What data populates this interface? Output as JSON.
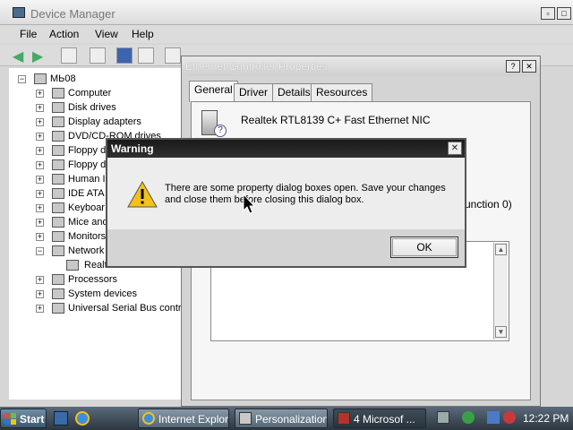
{
  "device_manager": {
    "title": "Device Manager",
    "menu": [
      "File",
      "Action",
      "View",
      "Help"
    ],
    "tree": {
      "root": "МЬ08",
      "items": [
        {
          "label": "Computer",
          "icon": "computer-icon",
          "expander": "+"
        },
        {
          "label": "Disk drives",
          "icon": "disk-icon",
          "expander": "+"
        },
        {
          "label": "Display adapters",
          "icon": "display-icon",
          "expander": "+"
        },
        {
          "label": "DVD/CD-ROM drives",
          "icon": "dvd-icon",
          "expander": "+"
        },
        {
          "label": "Floppy di",
          "icon": "floppy-icon",
          "expander": "+"
        },
        {
          "label": "Floppy di",
          "icon": "floppy-drive-icon",
          "expander": "+"
        },
        {
          "label": "Human In",
          "icon": "hid-icon",
          "expander": "+"
        },
        {
          "label": "IDE ATA",
          "icon": "ide-icon",
          "expander": "+"
        },
        {
          "label": "Keyboar",
          "icon": "keyboard-icon",
          "expander": "+"
        },
        {
          "label": "Mice and",
          "icon": "mouse-icon",
          "expander": "+"
        },
        {
          "label": "Monitors",
          "icon": "monitor-icon",
          "expander": "+"
        },
        {
          "label": "Network",
          "icon": "network-icon",
          "expander": "-"
        },
        {
          "label": "Realtek RTL8139 C",
          "icon": "nic-icon",
          "expander": ""
        },
        {
          "label": "Processors",
          "icon": "processor-icon",
          "expander": "+"
        },
        {
          "label": "System devices",
          "icon": "system-icon",
          "expander": "+"
        },
        {
          "label": "Universal Serial Bus contro",
          "icon": "usb-icon",
          "expander": "+"
        }
      ]
    }
  },
  "properties": {
    "title": "Ethernet Controller Properties",
    "help_btn": "?",
    "close_btn": "✕",
    "tabs": [
      "General",
      "Driver",
      "Details",
      "Resources"
    ],
    "device_name": "Realtek RTL8139 C+ Fast Ethernet NIC",
    "function_text": "unction 0)"
  },
  "warning": {
    "title": "Warning",
    "close_btn": "✕",
    "message_line1": "There are some property dialog boxes open. Save your changes",
    "message_line2": "and close them before closing this dialog box.",
    "ok_label": "OK"
  },
  "taskbar": {
    "start_label": "Start",
    "tasks": [
      {
        "label": "Internet Explor...",
        "icon": "ie-icon"
      },
      {
        "label": "Personalization",
        "icon": "personalization-icon"
      },
      {
        "label": "4 Microsof ...",
        "icon": "mmc-icon"
      }
    ],
    "clock": "12:22 PM"
  }
}
